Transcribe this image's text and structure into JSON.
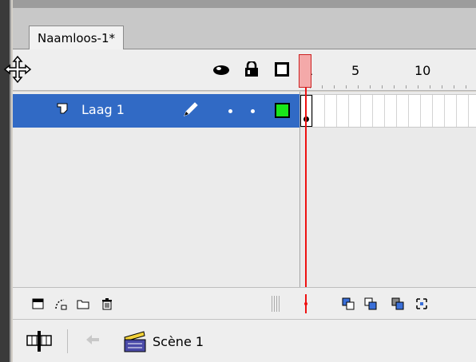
{
  "document": {
    "tab_title": "Naamloos-1*"
  },
  "header": {
    "icons": {
      "move": "move-icon",
      "show_hide": "eye-icon",
      "lock": "lock-icon",
      "outline": "outline-square-icon"
    },
    "frame_numbers": [
      "5",
      "10"
    ],
    "playhead_frame": "1"
  },
  "layers": [
    {
      "name": "Laag 1",
      "selected": true,
      "color": "#19e619",
      "editing": true
    }
  ],
  "colors": {
    "selection": "#316ac5",
    "playhead": "#ee1111",
    "layer_color": "#19e619"
  },
  "toolbar": {
    "left_icons": [
      "new-layer-icon",
      "add-motion-guide-icon",
      "new-folder-icon",
      "delete-layer-icon"
    ],
    "right_icons": [
      "center-frame-icon",
      "onion-skin-icon",
      "onion-skin-outlines-icon",
      "edit-multiple-frames-icon",
      "modify-onion-markers-icon"
    ]
  },
  "footer": {
    "scene_label": "Scène 1"
  }
}
